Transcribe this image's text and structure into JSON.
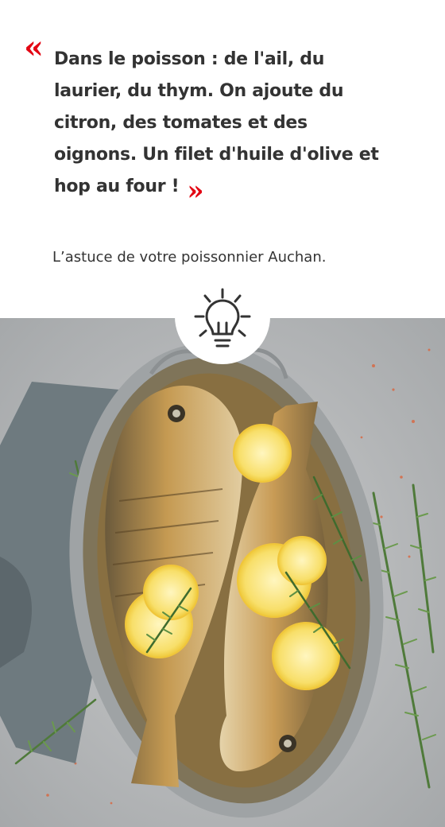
{
  "quote": {
    "open_mark": "«",
    "text": "Dans le poisson : de l'ail, du laurier, du thym. On ajoute du citron, des tomates et des oignons. Un filet d'huile d'olive et hop au four !",
    "close_mark": "»"
  },
  "attribution": "L’astuce de votre poissonnier Auchan.",
  "icons": {
    "tip": "lightbulb-icon"
  },
  "colors": {
    "accent": "#e30613",
    "text": "#333333",
    "background": "#ffffff"
  }
}
